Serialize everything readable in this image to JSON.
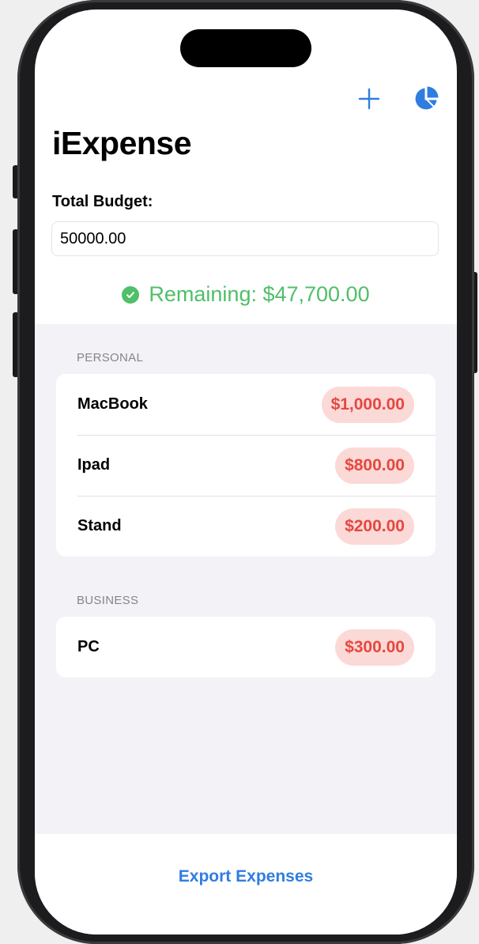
{
  "nav": {
    "add_icon": "plus-icon",
    "chart_icon": "pie-chart-icon",
    "accent_color": "#2f7de1"
  },
  "title": "iExpense",
  "budget": {
    "label": "Total Budget:",
    "value": "50000.00"
  },
  "remaining": {
    "text": "Remaining: $47,700.00",
    "icon": "checkmark-circle-icon",
    "color": "#4fbf68"
  },
  "sections": [
    {
      "header": "PERSONAL",
      "items": [
        {
          "name": "MacBook",
          "amount": "$1,000.00"
        },
        {
          "name": "Ipad",
          "amount": "$800.00"
        },
        {
          "name": "Stand",
          "amount": "$200.00"
        }
      ]
    },
    {
      "header": "BUSINESS",
      "items": [
        {
          "name": "PC",
          "amount": "$300.00"
        }
      ]
    }
  ],
  "amount_color": "#e5483f",
  "export_label": "Export Expenses"
}
